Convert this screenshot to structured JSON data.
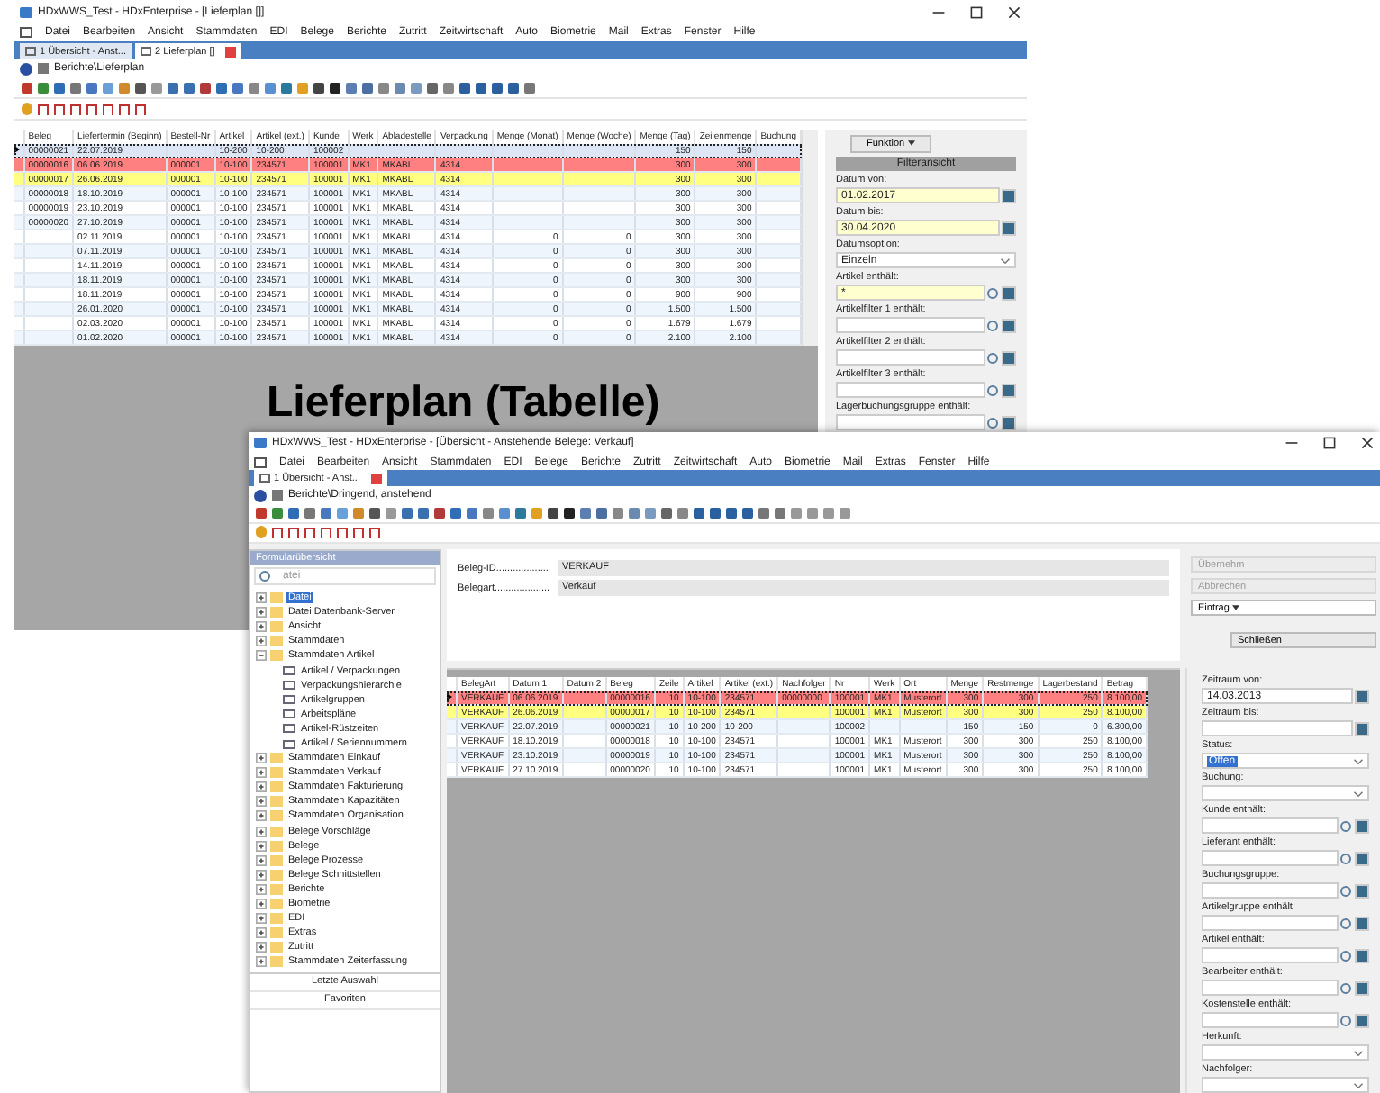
{
  "lieferplan_window": {
    "title": "HDxWWS_Test - HDxEnterprise - [Lieferplan []]",
    "menu": [
      "Datei",
      "Bearbeiten",
      "Ansicht",
      "Stammdaten",
      "EDI",
      "Belege",
      "Berichte",
      "Zutritt",
      "Zeitwirtschaft",
      "Auto",
      "Biometrie",
      "Mail",
      "Extras",
      "Fenster",
      "Hilfe"
    ],
    "tabs": [
      {
        "label": "1 Übersicht - Anst...",
        "selected": false
      },
      {
        "label": "2 Lieferplan []",
        "selected": true
      }
    ],
    "breadcrumb": "Berichte\\Lieferplan",
    "table": {
      "columns": [
        "Beleg",
        "Liefertermin (Beginn)",
        "Bestell-Nr",
        "Artikel",
        "Artikel (ext.)",
        "Kunde",
        "Werk",
        "Abladestelle",
        "Verpackung",
        "Menge (Monat)",
        "Menge (Woche)",
        "Menge (Tag)",
        "Zeilenmenge",
        "Buchung"
      ],
      "rows": [
        {
          "current": true,
          "cells": [
            "00000021",
            "22.07.2019",
            "",
            "10-200",
            "10-200",
            "100002",
            "",
            "",
            "",
            "",
            "",
            "150",
            "150",
            ""
          ]
        },
        {
          "current": false,
          "color": "#ff8080",
          "cells": [
            "00000016",
            "06.06.2019",
            "000001",
            "10-100",
            "234571",
            "100001",
            "MK1",
            "MKABL",
            "4314",
            "",
            "",
            "300",
            "300",
            ""
          ]
        },
        {
          "current": false,
          "color": "#ffff80",
          "cells": [
            "00000017",
            "26.06.2019",
            "000001",
            "10-100",
            "234571",
            "100001",
            "MK1",
            "MKABL",
            "4314",
            "",
            "",
            "300",
            "300",
            ""
          ]
        },
        {
          "current": false,
          "cells": [
            "00000018",
            "18.10.2019",
            "000001",
            "10-100",
            "234571",
            "100001",
            "MK1",
            "MKABL",
            "4314",
            "",
            "",
            "300",
            "300",
            ""
          ]
        },
        {
          "current": false,
          "cells": [
            "00000019",
            "23.10.2019",
            "000001",
            "10-100",
            "234571",
            "100001",
            "MK1",
            "MKABL",
            "4314",
            "",
            "",
            "300",
            "300",
            ""
          ]
        },
        {
          "current": false,
          "cells": [
            "00000020",
            "27.10.2019",
            "000001",
            "10-100",
            "234571",
            "100001",
            "MK1",
            "MKABL",
            "4314",
            "",
            "",
            "300",
            "300",
            ""
          ]
        },
        {
          "current": false,
          "cells": [
            "",
            "02.11.2019",
            "000001",
            "10-100",
            "234571",
            "100001",
            "MK1",
            "MKABL",
            "4314",
            "0",
            "0",
            "300",
            "300",
            ""
          ]
        },
        {
          "current": false,
          "cells": [
            "",
            "07.11.2019",
            "000001",
            "10-100",
            "234571",
            "100001",
            "MK1",
            "MKABL",
            "4314",
            "0",
            "0",
            "300",
            "300",
            ""
          ]
        },
        {
          "current": false,
          "cells": [
            "",
            "14.11.2019",
            "000001",
            "10-100",
            "234571",
            "100001",
            "MK1",
            "MKABL",
            "4314",
            "0",
            "0",
            "300",
            "300",
            ""
          ]
        },
        {
          "current": false,
          "cells": [
            "",
            "18.11.2019",
            "000001",
            "10-100",
            "234571",
            "100001",
            "MK1",
            "MKABL",
            "4314",
            "0",
            "0",
            "300",
            "300",
            ""
          ]
        },
        {
          "current": false,
          "cells": [
            "",
            "18.11.2019",
            "000001",
            "10-100",
            "234571",
            "100001",
            "MK1",
            "MKABL",
            "4314",
            "0",
            "0",
            "900",
            "900",
            ""
          ]
        },
        {
          "current": false,
          "cells": [
            "",
            "26.01.2020",
            "000001",
            "10-100",
            "234571",
            "100001",
            "MK1",
            "MKABL",
            "4314",
            "0",
            "0",
            "1.500",
            "1.500",
            ""
          ]
        },
        {
          "current": false,
          "cells": [
            "",
            "02.03.2020",
            "000001",
            "10-100",
            "234571",
            "100001",
            "MK1",
            "MKABL",
            "4314",
            "0",
            "0",
            "1.679",
            "1.679",
            ""
          ]
        },
        {
          "current": false,
          "cells": [
            "",
            "01.02.2020",
            "000001",
            "10-100",
            "234571",
            "100001",
            "MK1",
            "MKABL",
            "4314",
            "0",
            "0",
            "2.100",
            "2.100",
            ""
          ]
        }
      ]
    },
    "caption": "Lieferplan (Tabelle)",
    "filter_panel": {
      "function_button": "Funktion",
      "header": "Filteransicht",
      "fields": [
        {
          "label": "Datum von:",
          "value": "01.02.2017",
          "kind": "date",
          "required": true
        },
        {
          "label": "Datum bis:",
          "value": "30.04.2020",
          "kind": "date",
          "required": true
        },
        {
          "label": "Datumsoption:",
          "value": "Einzeln",
          "kind": "select",
          "required": false
        },
        {
          "label": "Artikel enthält:",
          "value": "*",
          "kind": "lookup",
          "required": true
        },
        {
          "label": "Artikelfilter 1 enthält:",
          "kind": "lookup",
          "required": false
        },
        {
          "label": "Artikelfilter 2 enthält:",
          "kind": "lookup",
          "required": false
        },
        {
          "label": "Artikelfilter 3 enthält:",
          "kind": "lookup",
          "required": false
        },
        {
          "label": "Lagerbuchungsgruppe enthält:",
          "kind": "lookup",
          "required": false
        }
      ]
    }
  },
  "overview_window": {
    "title": "HDxWWS_Test - HDxEnterprise - [Übersicht - Anstehende Belege: Verkauf]",
    "menu": [
      "Datei",
      "Bearbeiten",
      "Ansicht",
      "Stammdaten",
      "EDI",
      "Belege",
      "Berichte",
      "Zutritt",
      "Zeitwirtschaft",
      "Auto",
      "Biometrie",
      "Mail",
      "Extras",
      "Fenster",
      "Hilfe"
    ],
    "tabs": [
      {
        "label": "1 Übersicht - Anst...",
        "selected": true
      }
    ],
    "breadcrumb": "Berichte\\Dringend, anstehend",
    "sidebar": {
      "title": "Formularübersicht",
      "search": "atei",
      "tree": [
        {
          "label": "Datei",
          "kind": "folder",
          "expanded": false,
          "selected": true
        },
        {
          "label": "Datei Datenbank-Server",
          "kind": "folder",
          "expanded": false,
          "selected": false
        },
        {
          "label": "Ansicht",
          "kind": "folder",
          "expanded": false,
          "selected": false
        },
        {
          "label": "Stammdaten",
          "kind": "folder",
          "expanded": false,
          "selected": false
        },
        {
          "label": "Stammdaten Artikel",
          "kind": "folder",
          "expanded": true,
          "selected": false,
          "children": [
            {
              "label": "Artikel / Verpackungen",
              "kind": "form",
              "selected": false
            },
            {
              "label": "Verpackungshierarchie",
              "kind": "form",
              "selected": false
            },
            {
              "label": "Artikelgruppen",
              "kind": "form",
              "selected": false
            },
            {
              "label": "Arbeitspläne",
              "kind": "form",
              "selected": false
            },
            {
              "label": "Artikel-Rüstzeiten",
              "kind": "form",
              "selected": false
            },
            {
              "label": "Artikel / Seriennummern",
              "kind": "form",
              "selected": false
            }
          ]
        },
        {
          "label": "Stammdaten Einkauf",
          "kind": "folder",
          "expanded": false,
          "selected": false
        },
        {
          "label": "Stammdaten Verkauf",
          "kind": "folder",
          "expanded": false,
          "selected": false
        },
        {
          "label": "Stammdaten Fakturierung",
          "kind": "folder",
          "expanded": false,
          "selected": false
        },
        {
          "label": "Stammdaten Kapazitäten",
          "kind": "folder",
          "expanded": false,
          "selected": false
        },
        {
          "label": "Stammdaten Organisation",
          "kind": "folder",
          "expanded": false,
          "selected": false
        },
        {
          "label": "Belege Vorschläge",
          "kind": "folder",
          "expanded": false,
          "selected": false
        },
        {
          "label": "Belege",
          "kind": "folder",
          "expanded": false,
          "selected": false
        },
        {
          "label": "Belege Prozesse",
          "kind": "folder",
          "expanded": false,
          "selected": false
        },
        {
          "label": "Belege Schnittstellen",
          "kind": "folder",
          "expanded": false,
          "selected": false
        },
        {
          "label": "Berichte",
          "kind": "folder",
          "expanded": false,
          "selected": false
        },
        {
          "label": "Biometrie",
          "kind": "folder",
          "expanded": false,
          "selected": false
        },
        {
          "label": "EDI",
          "kind": "folder",
          "expanded": false,
          "selected": false
        },
        {
          "label": "Extras",
          "kind": "folder",
          "expanded": false,
          "selected": false
        },
        {
          "label": "Zutritt",
          "kind": "folder",
          "expanded": false,
          "selected": false
        },
        {
          "label": "Stammdaten Zeiterfassung",
          "kind": "folder",
          "expanded": false,
          "selected": false
        }
      ],
      "bottom": [
        "Letzte Auswahl",
        "Favoriten"
      ]
    },
    "header_fields": [
      {
        "label": "Beleg-ID...................",
        "value": "VERKAUF"
      },
      {
        "label": "Belegart....................",
        "value": "Verkauf"
      }
    ],
    "side_buttons": [
      {
        "label": "Übernehm",
        "disabled": true
      },
      {
        "label": "Abbrechen",
        "disabled": true
      }
    ],
    "entry_dropdown": "Eintrag",
    "close_button": "Schließen",
    "table": {
      "columns": [
        "BelegArt",
        "Datum 1",
        "Datum 2",
        "Beleg",
        "Zeile",
        "Artikel",
        "Artikel (ext.)",
        "Nachfolger",
        "Nr",
        "Werk",
        "Ort",
        "Menge",
        "Restmenge",
        "Lagerbestand",
        "Betrag"
      ],
      "rows": [
        {
          "current": true,
          "color": "#ff8080",
          "cells": [
            "VERKAUF",
            "06.06.2019",
            "",
            "00000016",
            "10",
            "10-100",
            "234571",
            "00000000",
            "100001",
            "MK1",
            "Musterort",
            "300",
            "300",
            "250",
            "8.100,00"
          ]
        },
        {
          "current": false,
          "color": "#ffff80",
          "cells": [
            "VERKAUF",
            "26.06.2019",
            "",
            "00000017",
            "10",
            "10-100",
            "234571",
            "",
            "100001",
            "MK1",
            "Musterort",
            "300",
            "300",
            "250",
            "8.100,00"
          ]
        },
        {
          "current": false,
          "cells": [
            "VERKAUF",
            "22.07.2019",
            "",
            "00000021",
            "10",
            "10-200",
            "10-200",
            "",
            "100002",
            "",
            "",
            "150",
            "150",
            "0",
            "6.300,00"
          ]
        },
        {
          "current": false,
          "cells": [
            "VERKAUF",
            "18.10.2019",
            "",
            "00000018",
            "10",
            "10-100",
            "234571",
            "",
            "100001",
            "MK1",
            "Musterort",
            "300",
            "300",
            "250",
            "8.100,00"
          ]
        },
        {
          "current": false,
          "cells": [
            "VERKAUF",
            "23.10.2019",
            "",
            "00000019",
            "10",
            "10-100",
            "234571",
            "",
            "100001",
            "MK1",
            "Musterort",
            "300",
            "300",
            "250",
            "8.100,00"
          ]
        },
        {
          "current": false,
          "cells": [
            "VERKAUF",
            "27.10.2019",
            "",
            "00000020",
            "10",
            "10-100",
            "234571",
            "",
            "100001",
            "MK1",
            "Musterort",
            "300",
            "300",
            "250",
            "8.100,00"
          ]
        }
      ]
    },
    "filters": [
      {
        "label": "Zeitraum von:",
        "value": "14.03.2013",
        "kind": "date"
      },
      {
        "label": "Zeitraum bis:",
        "kind": "date"
      },
      {
        "label": "Status:",
        "value": "Offen",
        "kind": "select"
      },
      {
        "label": "Buchung:",
        "kind": "select"
      },
      {
        "label": "Kunde enthält:",
        "kind": "lookup"
      },
      {
        "label": "Lieferant enthält:",
        "kind": "lookup"
      },
      {
        "label": "Buchungsgruppe:",
        "kind": "lookup"
      },
      {
        "label": "Artikelgruppe enthält:",
        "kind": "lookup"
      },
      {
        "label": "Artikel enthält:",
        "kind": "lookup"
      },
      {
        "label": "Bearbeiter enthält:",
        "kind": "lookup"
      },
      {
        "label": "Kostenstelle enthält:",
        "kind": "lookup"
      },
      {
        "label": "Herkunft:",
        "kind": "select"
      },
      {
        "label": "Nachfolger:",
        "kind": "select"
      }
    ]
  }
}
